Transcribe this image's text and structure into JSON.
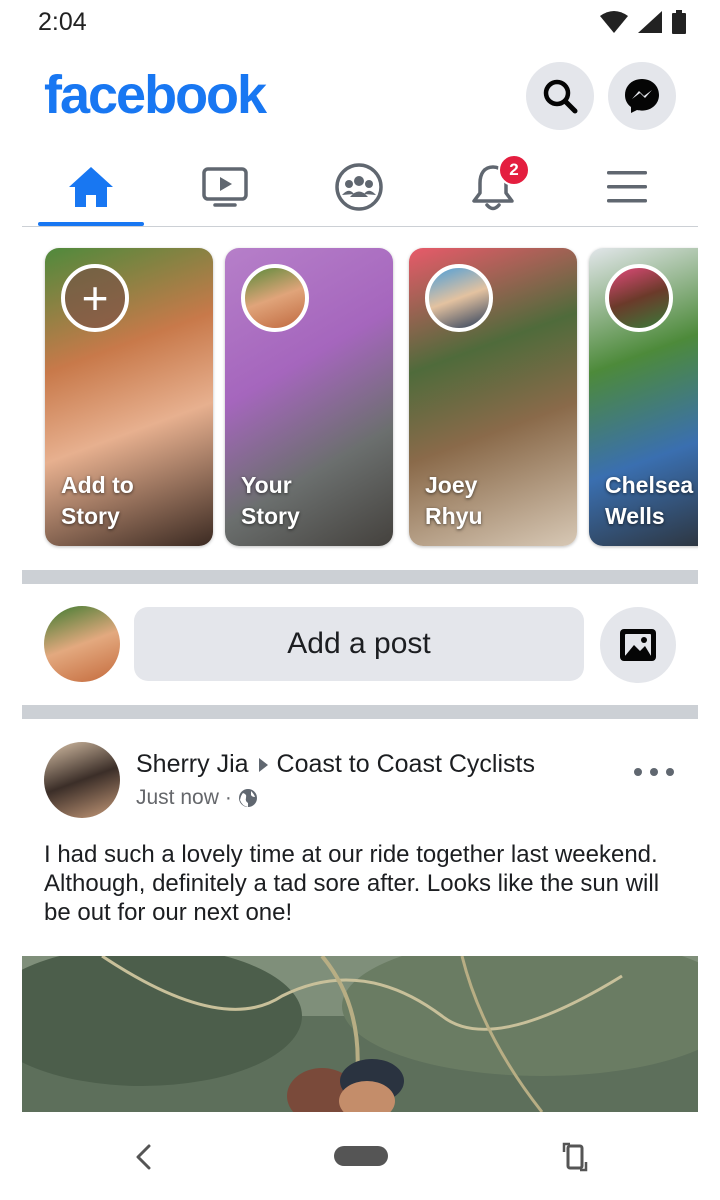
{
  "status_bar": {
    "time": "2:04",
    "icons": [
      "wifi-icon",
      "signal-icon",
      "battery-icon"
    ]
  },
  "header": {
    "logo": "facebook",
    "actions": [
      "search-icon",
      "messenger-icon"
    ]
  },
  "tabs": {
    "items": [
      {
        "name": "home",
        "icon": "home-icon",
        "active": true
      },
      {
        "name": "watch",
        "icon": "video-icon",
        "active": false
      },
      {
        "name": "groups",
        "icon": "groups-icon",
        "active": false
      },
      {
        "name": "notifications",
        "icon": "bell-icon",
        "active": false,
        "badge": "2"
      },
      {
        "name": "menu",
        "icon": "hamburger-icon",
        "active": false
      }
    ]
  },
  "stories": [
    {
      "label": "Add to\nStory",
      "type": "add"
    },
    {
      "label": "Your\nStory"
    },
    {
      "label": "Joey\nRhyu"
    },
    {
      "label": "Chelsea\nWells"
    }
  ],
  "composer": {
    "placeholder": "Add a post"
  },
  "post": {
    "author": "Sherry Jia",
    "group": "Coast to Coast Cyclists",
    "time": "Just now",
    "privacy_icon": "globe-icon",
    "text": "I had such a lovely time at our ride together last weekend. Although, definitely a tad sore after. Looks like the sun will be out for our next one!"
  },
  "colors": {
    "brand": "#1877f2",
    "badge": "#e41e3f",
    "divider": "#ccd0d5",
    "button_bg": "#e4e6eb"
  },
  "nav_bar": {
    "buttons": [
      "back-icon",
      "home-pill",
      "rotate-icon"
    ]
  }
}
